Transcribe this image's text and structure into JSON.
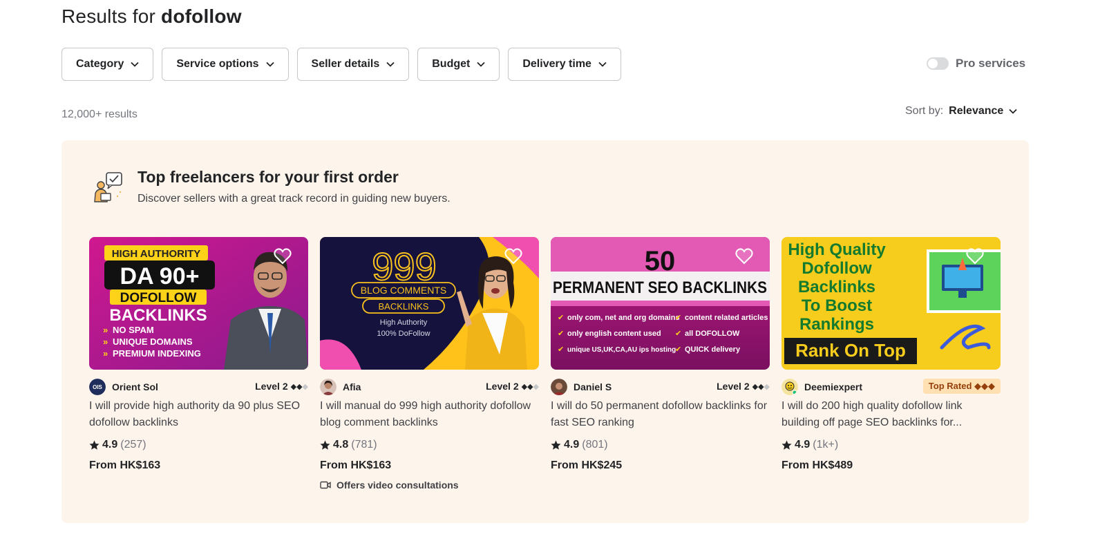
{
  "header": {
    "title_prefix": "Results for",
    "query": "dofollow"
  },
  "filters": [
    {
      "label": "Category"
    },
    {
      "label": "Service options"
    },
    {
      "label": "Seller details"
    },
    {
      "label": "Budget"
    },
    {
      "label": "Delivery time"
    }
  ],
  "pro_services": {
    "label": "Pro services",
    "enabled": false
  },
  "results": {
    "count": "12,000+ results"
  },
  "sort": {
    "label": "Sort by:",
    "value": "Relevance"
  },
  "panel": {
    "title": "Top freelancers for your first order",
    "subtitle": "Discover sellers with a great track record in guiding new buyers."
  },
  "colors": {
    "panel_bg": "#fdf4ec",
    "top_rated_bg": "#ffe0b3",
    "top_rated_text": "#95400b",
    "online_dot": "#1dbf73"
  },
  "cards": [
    {
      "seller": "Orient Sol",
      "avatar_text": "OIS",
      "level": "Level 2",
      "badge_type": "level",
      "title": "I will provide high authority da 90 plus SEO dofollow backlinks",
      "score": "4.9",
      "reviews": "(257)",
      "price": "From HK$163",
      "extra": "",
      "thumb": {
        "line1": "HIGH AUTHORITY",
        "line2": "DA 90+",
        "line3": "DOFOLLOW",
        "line4": "BACKLINKS",
        "bullets": [
          "NO SPAM",
          "UNIQUE DOMAINS",
          "PREMIUM INDEXING"
        ]
      }
    },
    {
      "seller": "Afia",
      "avatar_text": "",
      "level": "Level 2",
      "badge_type": "level",
      "title": "I will manual do 999 high authority dofollow blog comment backlinks",
      "score": "4.8",
      "reviews": "(781)",
      "price": "From HK$163",
      "extra": "Offers video consultations",
      "thumb": {
        "line1": "999",
        "line2": "BLOG COMMENTS",
        "line3": "BACKLINKS",
        "line4": "High Authority",
        "line5": "100% DoFollow"
      }
    },
    {
      "seller": "Daniel S",
      "avatar_text": "",
      "level": "Level 2",
      "badge_type": "level",
      "title": "I will do 50 permanent dofollow backlinks for fast SEO ranking",
      "score": "4.9",
      "reviews": "(801)",
      "price": "From HK$245",
      "extra": "",
      "thumb": {
        "line1": "50",
        "line2": "PERMANENT SEO BACKLINKS",
        "bullets_left": [
          "only com, net and org domains",
          "only english content used",
          "unique US,UK,CA,AU ips hosting"
        ],
        "bullets_right": [
          "content related articles",
          "all DOFOLLOW",
          "QUICK delivery"
        ]
      }
    },
    {
      "seller": "Deemiexpert",
      "avatar_text": "",
      "level": "Top Rated ◆◆◆",
      "badge_type": "top",
      "title": "I will do 200 high quality dofollow link building off page SEO backlinks for...",
      "score": "4.9",
      "reviews": "(1k+)",
      "price": "From HK$489",
      "extra": "",
      "thumb": {
        "line1": "High Quality",
        "line2": "Dofollow",
        "line3": "Backlinks",
        "line4": "To Boost",
        "line5": "Rankings",
        "banner": "Rank On Top"
      }
    }
  ]
}
